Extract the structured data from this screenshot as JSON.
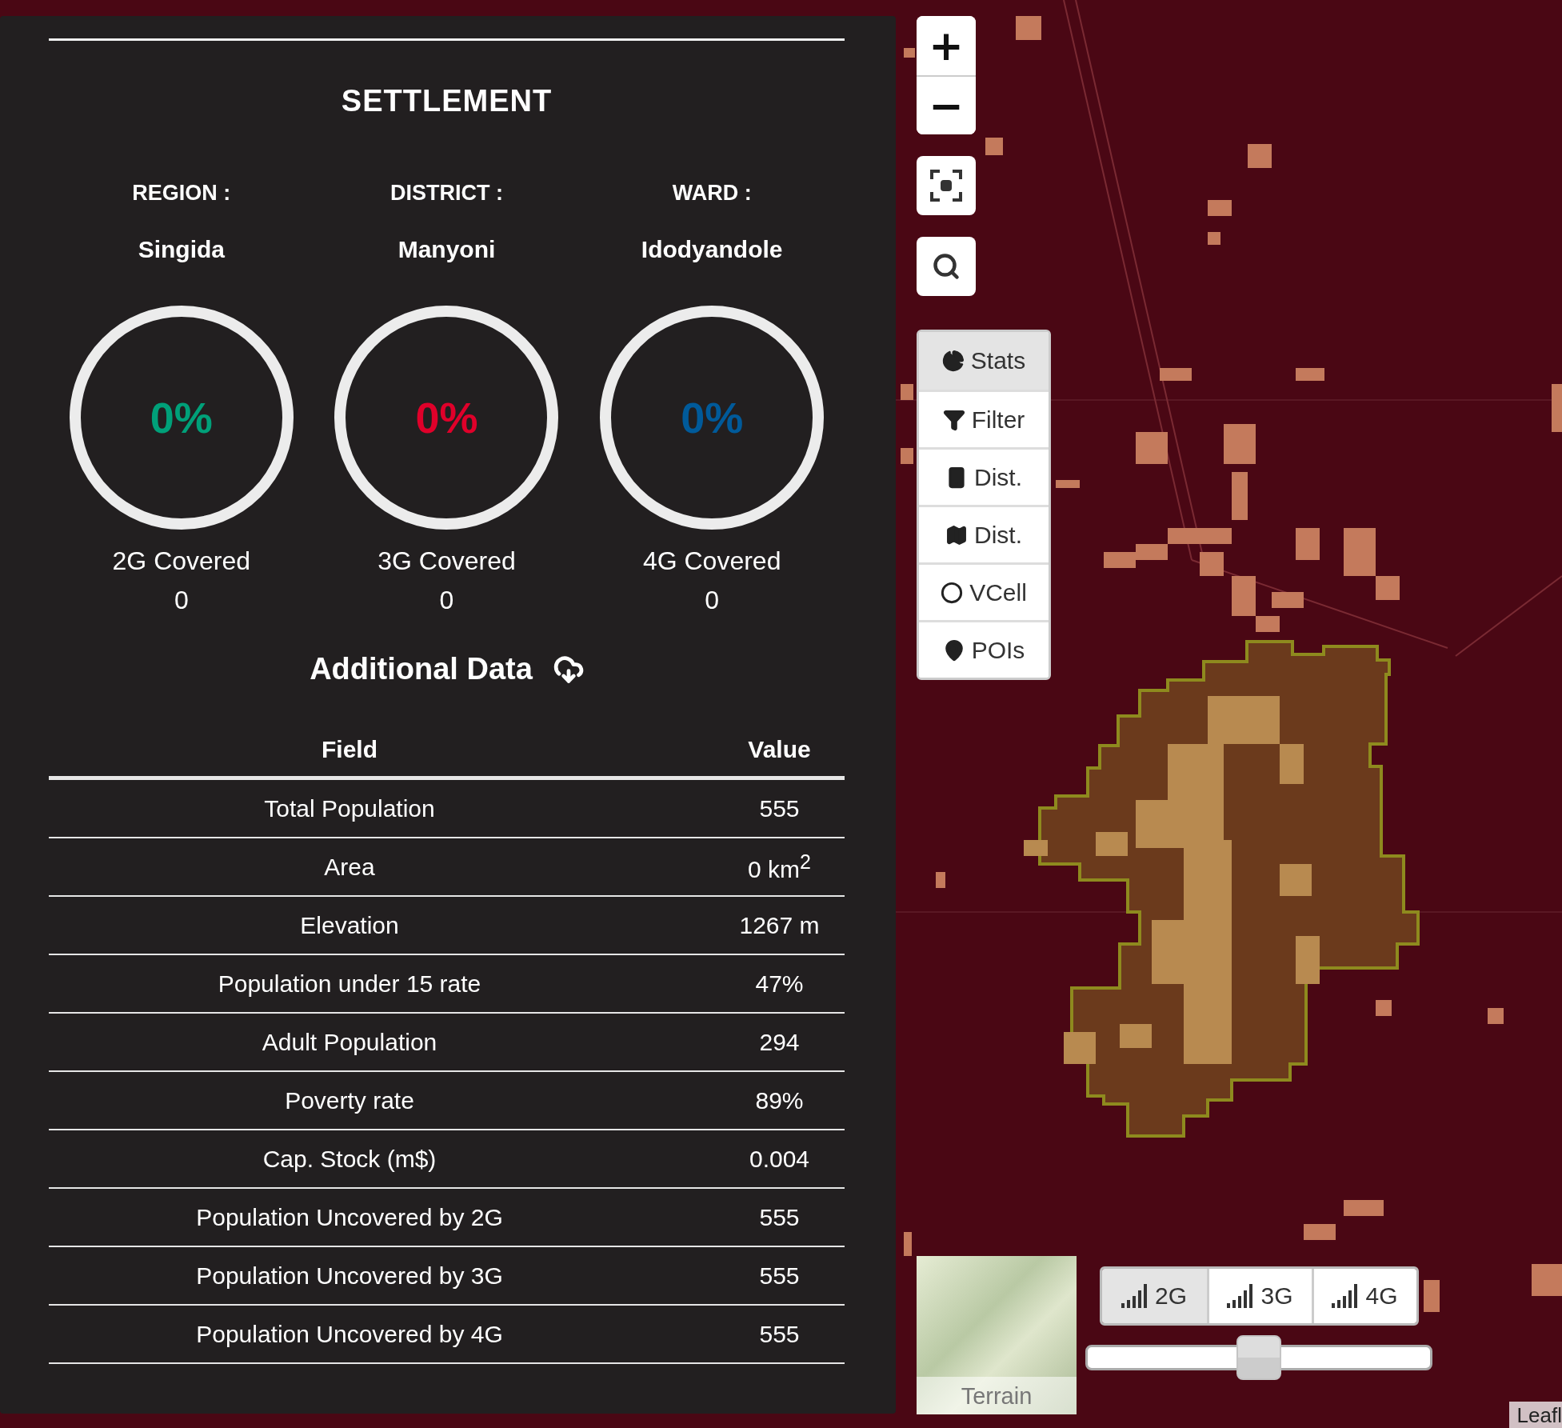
{
  "panel": {
    "title": "SETTLEMENT",
    "locations": [
      {
        "label": "REGION :",
        "value": "Singida"
      },
      {
        "label": "DISTRICT :",
        "value": "Manyoni"
      },
      {
        "label": "WARD :",
        "value": "Idodyandole"
      }
    ],
    "coverage": [
      {
        "percent": "0%",
        "color": "#00a079",
        "level": 0,
        "label": "2G Covered",
        "count": "0"
      },
      {
        "percent": "0%",
        "color": "#e0002a",
        "level": 0,
        "label": "3G Covered",
        "count": "0"
      },
      {
        "percent": "0%",
        "color": "#005a9a",
        "level": 0,
        "label": "4G Covered",
        "count": "0"
      }
    ],
    "additional_title": "Additional Data",
    "table": {
      "columns": [
        "Field",
        "Value"
      ],
      "rows": [
        [
          "Total Population",
          "555"
        ],
        [
          "Area",
          "0 km$^{2}$"
        ],
        [
          "Elevation",
          "1267 m"
        ],
        [
          "Population under 15 rate",
          "47%"
        ],
        [
          "Adult Population",
          "294"
        ],
        [
          "Poverty rate",
          "89%"
        ],
        [
          "Cap. Stock (m$)",
          "0.004"
        ],
        [
          "Population Uncovered by 2G",
          "555"
        ],
        [
          "Population Uncovered by 3G",
          "555"
        ],
        [
          "Population Uncovered by 4G",
          "555"
        ]
      ]
    }
  },
  "map": {
    "zoom_in": "+",
    "zoom_out": "−",
    "menu": [
      {
        "label": "Stats",
        "selected": true
      },
      {
        "label": "Filter",
        "selected": false
      },
      {
        "label": "Dist.",
        "selected": false
      },
      {
        "label": "Dist.",
        "selected": false
      },
      {
        "label": "VCell",
        "selected": false
      },
      {
        "label": "POIs",
        "selected": false
      }
    ],
    "layer": {
      "label": "Terrain"
    },
    "networks": [
      {
        "label": "2G",
        "selected": true
      },
      {
        "label": "3G",
        "selected": false
      },
      {
        "label": "4G",
        "selected": false
      }
    ],
    "slider": {
      "level": 0.5
    },
    "attribution": "Leafl"
  }
}
